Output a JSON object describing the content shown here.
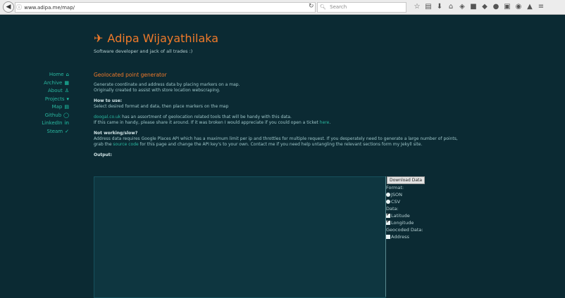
{
  "browser": {
    "url": "www.adipa.me/map/",
    "search_placeholder": "Search"
  },
  "header": {
    "title": "Adipa Wijayathilaka",
    "tagline": "Software developer and jack of all trades :)"
  },
  "sidebar": {
    "items": [
      {
        "label": "Home",
        "icon": "home-icon",
        "glyph": "⌂"
      },
      {
        "label": "Archive",
        "icon": "archive-icon",
        "glyph": "▦"
      },
      {
        "label": "About",
        "icon": "user-icon",
        "glyph": "♙"
      },
      {
        "label": "Projects",
        "icon": "caret-down-icon",
        "glyph": "▾"
      },
      {
        "label": "Map",
        "icon": "map-icon",
        "glyph": "▤"
      },
      {
        "label": "Github",
        "icon": "github-icon",
        "glyph": "◯"
      },
      {
        "label": "LinkedIn",
        "icon": "linkedin-icon",
        "glyph": "in"
      },
      {
        "label": "Steam",
        "icon": "steam-icon",
        "glyph": "✓"
      }
    ]
  },
  "main": {
    "heading": "Geolocated point generator",
    "intro_line1": "Generate coordinate and address data by placing markers on a map.",
    "intro_line2": "Originally created to assist with store location webscraping.",
    "howto_heading": "How to use:",
    "howto_text": "Select desired format and data, then place markers on the map",
    "doogal_link": "doogal.co.uk",
    "doogal_text": " has an assortment of geolocation related tools that will be handy with this data.",
    "share_text": "If this came in handy, please share it around. If it was broken I would appreciate if you could open a ticket ",
    "here_link": "here",
    "notworking_heading": "Not working/slow?",
    "notworking_text": "Address data requires Google Places API which has a maximum limit per ip and throttles for multiple request. If you desperately need to generate a large number of points,",
    "grab_text1": "grab the ",
    "source_link": "source code",
    "grab_text2": " for this page and change the API key's to your own. Contact me if you need help untangling the relevant sections form my Jekyll site.",
    "output_label": "Output:"
  },
  "controls": {
    "download_button": "Download Data",
    "format_label": "Format:",
    "format_options": [
      "JSON",
      "CSV"
    ],
    "data_label": "Data:",
    "data_options": [
      "Latitude",
      "Longitude"
    ],
    "geocoded_label": "Geocoded Data:",
    "address_label": "Address"
  }
}
